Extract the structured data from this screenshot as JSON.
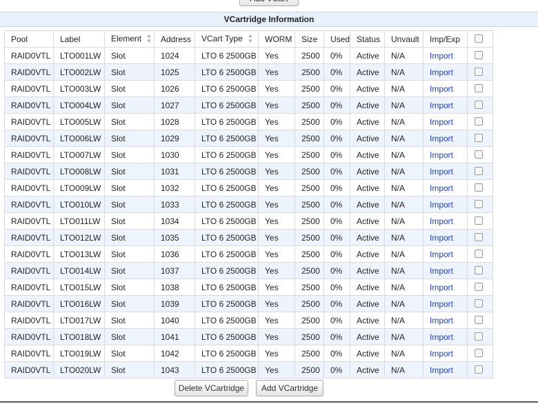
{
  "top_button_label": "Add VCart",
  "section_title": "VCartridge Information",
  "columns": [
    "Pool",
    "Label",
    "Element",
    "Address",
    "VCart Type",
    "WORM",
    "Size",
    "Used",
    "Status",
    "Unvault",
    "Imp/Exp"
  ],
  "rows": [
    {
      "pool": "RAID0VTL",
      "label": "LTO001LW",
      "element": "Slot",
      "address": "1024",
      "type": "LTO 6 2500GB",
      "worm": "Yes",
      "size": "2500",
      "used": "0%",
      "status": "Active",
      "unvault": "N/A",
      "impexp": "Import"
    },
    {
      "pool": "RAID0VTL",
      "label": "LTO002LW",
      "element": "Slot",
      "address": "1025",
      "type": "LTO 6 2500GB",
      "worm": "Yes",
      "size": "2500",
      "used": "0%",
      "status": "Active",
      "unvault": "N/A",
      "impexp": "Import"
    },
    {
      "pool": "RAID0VTL",
      "label": "LTO003LW",
      "element": "Slot",
      "address": "1026",
      "type": "LTO 6 2500GB",
      "worm": "Yes",
      "size": "2500",
      "used": "0%",
      "status": "Active",
      "unvault": "N/A",
      "impexp": "Import"
    },
    {
      "pool": "RAID0VTL",
      "label": "LTO004LW",
      "element": "Slot",
      "address": "1027",
      "type": "LTO 6 2500GB",
      "worm": "Yes",
      "size": "2500",
      "used": "0%",
      "status": "Active",
      "unvault": "N/A",
      "impexp": "Import"
    },
    {
      "pool": "RAID0VTL",
      "label": "LTO005LW",
      "element": "Slot",
      "address": "1028",
      "type": "LTO 6 2500GB",
      "worm": "Yes",
      "size": "2500",
      "used": "0%",
      "status": "Active",
      "unvault": "N/A",
      "impexp": "Import"
    },
    {
      "pool": "RAID0VTL",
      "label": "LTO006LW",
      "element": "Slot",
      "address": "1029",
      "type": "LTO 6 2500GB",
      "worm": "Yes",
      "size": "2500",
      "used": "0%",
      "status": "Active",
      "unvault": "N/A",
      "impexp": "Import"
    },
    {
      "pool": "RAID0VTL",
      "label": "LTO007LW",
      "element": "Slot",
      "address": "1030",
      "type": "LTO 6 2500GB",
      "worm": "Yes",
      "size": "2500",
      "used": "0%",
      "status": "Active",
      "unvault": "N/A",
      "impexp": "Import"
    },
    {
      "pool": "RAID0VTL",
      "label": "LTO008LW",
      "element": "Slot",
      "address": "1031",
      "type": "LTO 6 2500GB",
      "worm": "Yes",
      "size": "2500",
      "used": "0%",
      "status": "Active",
      "unvault": "N/A",
      "impexp": "Import"
    },
    {
      "pool": "RAID0VTL",
      "label": "LTO009LW",
      "element": "Slot",
      "address": "1032",
      "type": "LTO 6 2500GB",
      "worm": "Yes",
      "size": "2500",
      "used": "0%",
      "status": "Active",
      "unvault": "N/A",
      "impexp": "Import"
    },
    {
      "pool": "RAID0VTL",
      "label": "LTO010LW",
      "element": "Slot",
      "address": "1033",
      "type": "LTO 6 2500GB",
      "worm": "Yes",
      "size": "2500",
      "used": "0%",
      "status": "Active",
      "unvault": "N/A",
      "impexp": "Import"
    },
    {
      "pool": "RAID0VTL",
      "label": "LTO011LW",
      "element": "Slot",
      "address": "1034",
      "type": "LTO 6 2500GB",
      "worm": "Yes",
      "size": "2500",
      "used": "0%",
      "status": "Active",
      "unvault": "N/A",
      "impexp": "Import"
    },
    {
      "pool": "RAID0VTL",
      "label": "LTO012LW",
      "element": "Slot",
      "address": "1035",
      "type": "LTO 6 2500GB",
      "worm": "Yes",
      "size": "2500",
      "used": "0%",
      "status": "Active",
      "unvault": "N/A",
      "impexp": "Import"
    },
    {
      "pool": "RAID0VTL",
      "label": "LTO013LW",
      "element": "Slot",
      "address": "1036",
      "type": "LTO 6 2500GB",
      "worm": "Yes",
      "size": "2500",
      "used": "0%",
      "status": "Active",
      "unvault": "N/A",
      "impexp": "Import"
    },
    {
      "pool": "RAID0VTL",
      "label": "LTO014LW",
      "element": "Slot",
      "address": "1037",
      "type": "LTO 6 2500GB",
      "worm": "Yes",
      "size": "2500",
      "used": "0%",
      "status": "Active",
      "unvault": "N/A",
      "impexp": "Import"
    },
    {
      "pool": "RAID0VTL",
      "label": "LTO015LW",
      "element": "Slot",
      "address": "1038",
      "type": "LTO 6 2500GB",
      "worm": "Yes",
      "size": "2500",
      "used": "0%",
      "status": "Active",
      "unvault": "N/A",
      "impexp": "Import"
    },
    {
      "pool": "RAID0VTL",
      "label": "LTO016LW",
      "element": "Slot",
      "address": "1039",
      "type": "LTO 6 2500GB",
      "worm": "Yes",
      "size": "2500",
      "used": "0%",
      "status": "Active",
      "unvault": "N/A",
      "impexp": "Import"
    },
    {
      "pool": "RAID0VTL",
      "label": "LTO017LW",
      "element": "Slot",
      "address": "1040",
      "type": "LTO 6 2500GB",
      "worm": "Yes",
      "size": "2500",
      "used": "0%",
      "status": "Active",
      "unvault": "N/A",
      "impexp": "Import"
    },
    {
      "pool": "RAID0VTL",
      "label": "LTO018LW",
      "element": "Slot",
      "address": "1041",
      "type": "LTO 6 2500GB",
      "worm": "Yes",
      "size": "2500",
      "used": "0%",
      "status": "Active",
      "unvault": "N/A",
      "impexp": "Import"
    },
    {
      "pool": "RAID0VTL",
      "label": "LTO019LW",
      "element": "Slot",
      "address": "1042",
      "type": "LTO 6 2500GB",
      "worm": "Yes",
      "size": "2500",
      "used": "0%",
      "status": "Active",
      "unvault": "N/A",
      "impexp": "Import"
    },
    {
      "pool": "RAID0VTL",
      "label": "LTO020LW",
      "element": "Slot",
      "address": "1043",
      "type": "LTO 6 2500GB",
      "worm": "Yes",
      "size": "2500",
      "used": "0%",
      "status": "Active",
      "unvault": "N/A",
      "impexp": "Import"
    }
  ],
  "buttons": {
    "delete_label": "Delete VCartridge",
    "add_label": "Add VCartridge"
  },
  "colors": {
    "link": "#1a3fd0",
    "stripe": "#eef4fd",
    "header_band": "#e8f0fb"
  }
}
